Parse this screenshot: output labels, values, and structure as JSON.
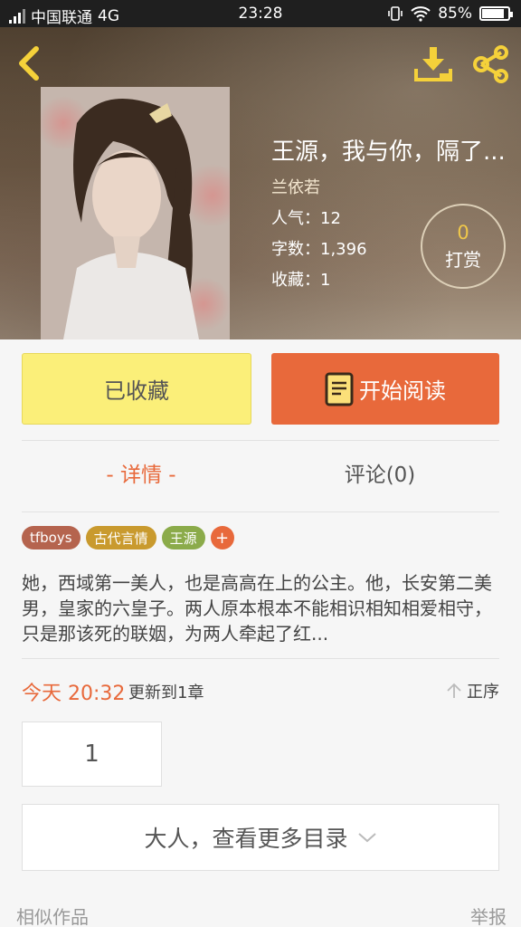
{
  "status_bar": {
    "carrier": "中国联通",
    "network": "4G",
    "time": "23:28",
    "battery": "85%",
    "battery_level": 0.85
  },
  "book": {
    "title": "王源，我与你，隔了...",
    "author": "兰依若",
    "popularity_label": "人气：12",
    "word_count_label": "字数：1,396",
    "favorites_label": "收藏：1",
    "tip_count": "0",
    "tip_label": "打赏"
  },
  "actions": {
    "collected_label": "已收藏",
    "start_reading_label": "开始阅读"
  },
  "tabs": {
    "detail_label": "- 详情 -",
    "comment_label": "评论(0)"
  },
  "tags": [
    {
      "label": "tfboys",
      "color": "#b5644e"
    },
    {
      "label": "古代言情",
      "color": "#c99a2e"
    },
    {
      "label": "王源",
      "color": "#8bab4a"
    }
  ],
  "tag_add_label": "+",
  "description": "她，西域第一美人，也是高高在上的公主。他，长安第二美男，皇家的六皇子。两人原本根本不能相识相知相爱相守，只是那该死的联姻，为两人牵起了红...",
  "update": {
    "time": "今天 20:32",
    "text": "更新到1章",
    "sort_label": "正序"
  },
  "chapters": [
    "1"
  ],
  "more_catalog_label": "大人，查看更多目录",
  "footer": {
    "similar_label": "相似作品",
    "report_label": "举报"
  },
  "colors": {
    "accent": "#e8693b",
    "collected_bg": "#fbef79",
    "icon_yellow": "#f5d13a"
  },
  "icons": [
    "back-icon",
    "download-icon",
    "share-icon",
    "book-icon",
    "arrow-up-icon",
    "chevron-down-icon"
  ]
}
